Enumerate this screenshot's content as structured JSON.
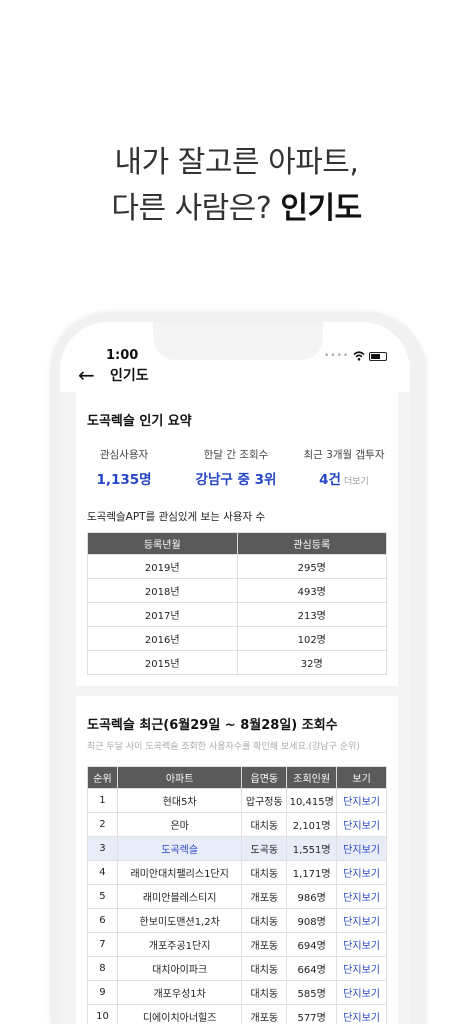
{
  "headline": {
    "line1": "내가 잘고른 아파트,",
    "line2_prefix": "다른 사람은? ",
    "line2_bold": "인기도"
  },
  "status_bar": {
    "time": "1:00",
    "icons": [
      "signal-dots-icon",
      "wifi-icon",
      "battery-icon"
    ]
  },
  "nav": {
    "back_icon": "←",
    "title": "인기도"
  },
  "summary": {
    "title": "도곡렉슬 인기 요약",
    "items": [
      {
        "label": "관심사용자",
        "value": "1,135명"
      },
      {
        "label": "한달 간 조회수",
        "value": "강남구 중 3위"
      },
      {
        "label": "최근 3개월 갭투자",
        "value": "4건",
        "more": "더보기"
      }
    ],
    "interest_title": "도곡렉슬APT를 관심있게 보는 사용자 수",
    "interest_headers": [
      "등록년월",
      "관심등록"
    ],
    "interest_rows": [
      [
        "2019년",
        "295명"
      ],
      [
        "2018년",
        "493명"
      ],
      [
        "2017년",
        "213명"
      ],
      [
        "2016년",
        "102명"
      ],
      [
        "2015년",
        "32명"
      ]
    ]
  },
  "views": {
    "title": "도곡렉슬 최근(6월29일 ~ 8월28일) 조회수",
    "desc": "최근 두달 사이 도곡렉슬 조회한 사용자수를 확인해 보세요.(강남구 순위)",
    "headers": [
      "순위",
      "아파트",
      "읍면동",
      "조회인원",
      "보기"
    ],
    "rows": [
      [
        "1",
        "현대5차",
        "압구정동",
        "10,415명",
        "단지보기"
      ],
      [
        "2",
        "은마",
        "대치동",
        "2,101명",
        "단지보기"
      ],
      [
        "3",
        "도곡렉슬",
        "도곡동",
        "1,551명",
        "단지보기"
      ],
      [
        "4",
        "래미안대치팰리스1단지",
        "대치동",
        "1,171명",
        "단지보기"
      ],
      [
        "5",
        "래미안블레스티지",
        "개포동",
        "986명",
        "단지보기"
      ],
      [
        "6",
        "한보미도맨션1,2차",
        "대치동",
        "908명",
        "단지보기"
      ],
      [
        "7",
        "개포주공1단지",
        "개포동",
        "694명",
        "단지보기"
      ],
      [
        "8",
        "대치아이파크",
        "대치동",
        "664명",
        "단지보기"
      ],
      [
        "9",
        "개포우성1차",
        "대치동",
        "585명",
        "단지보기"
      ],
      [
        "10",
        "디에이치아너힐즈",
        "개포동",
        "577명",
        "단지보기"
      ]
    ],
    "highlight_index": 2,
    "colors": {
      "accent": "#2446c7",
      "header_bg": "#5a5a5a",
      "highlight_bg": "#e8ecf8"
    }
  }
}
